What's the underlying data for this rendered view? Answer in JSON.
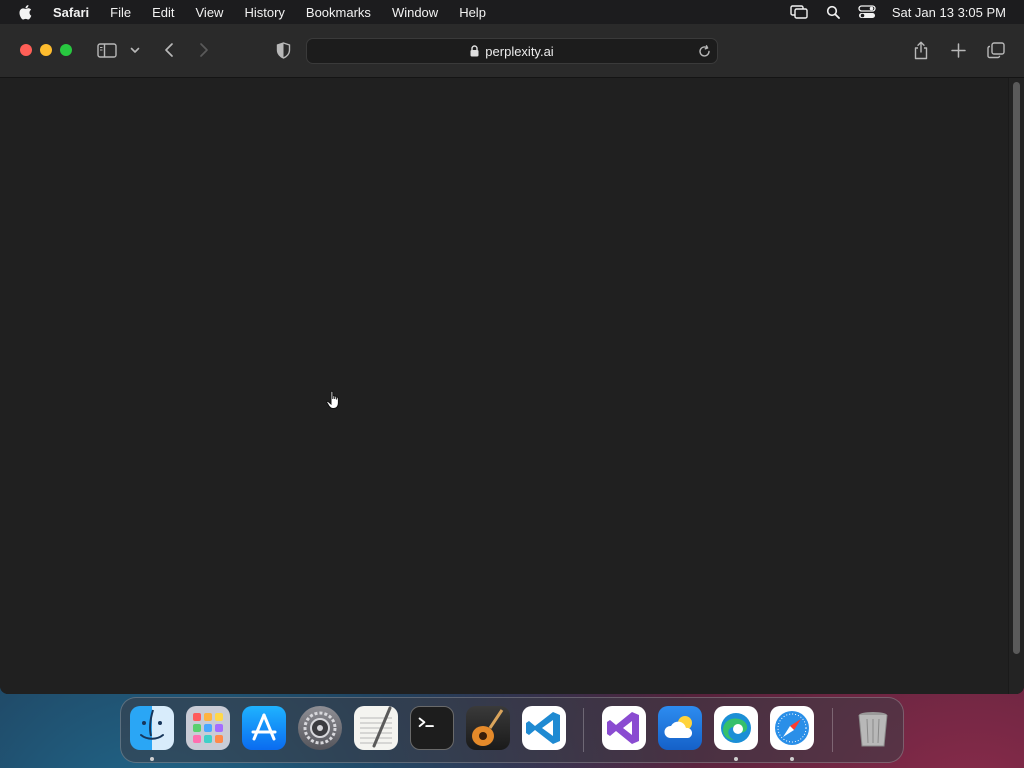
{
  "menubar": {
    "apple_icon": "apple-logo-icon",
    "app_name": "Safari",
    "items": [
      "File",
      "Edit",
      "View",
      "History",
      "Bookmarks",
      "Window",
      "Help"
    ],
    "status_icons": [
      "screen-mirroring-icon",
      "spotlight-search-icon",
      "control-center-icon"
    ],
    "clock": "Sat Jan 13  3:05 PM"
  },
  "toolbar": {
    "traffic_lights": {
      "close": "#ff5f57",
      "minimize": "#febc2e",
      "zoom": "#28c840"
    },
    "icons": {
      "sidebar": "sidebar-icon",
      "tab_groups": "chevron-down-icon",
      "back": "chevron-left-icon",
      "forward": "chevron-right-icon",
      "privacy": "shield-icon",
      "share": "share-icon",
      "new_tab": "plus-icon",
      "tab_overview": "tab-overview-icon"
    },
    "address": {
      "lock_icon": "lock-icon",
      "url": "perplexity.ai",
      "reload_icon": "reload-icon"
    }
  },
  "content": {
    "background": "#202020",
    "cursor_icon": "hand-pointer-icon"
  },
  "dock": {
    "apps": [
      {
        "name": "Finder",
        "icon": "finder-icon",
        "running": true
      },
      {
        "name": "Launchpad",
        "icon": "launchpad-icon",
        "running": false
      },
      {
        "name": "App Store",
        "icon": "app-store-icon",
        "running": false
      },
      {
        "name": "System Settings",
        "icon": "system-settings-icon",
        "running": false
      },
      {
        "name": "TextEdit",
        "icon": "textedit-icon",
        "running": false
      },
      {
        "name": "Terminal",
        "icon": "terminal-icon",
        "running": false
      },
      {
        "name": "GarageBand",
        "icon": "garageband-icon",
        "running": false
      },
      {
        "name": "Visual Studio Code",
        "icon": "vscode-icon",
        "running": false
      },
      {
        "name": "Visual Studio",
        "icon": "visual-studio-icon",
        "running": false
      },
      {
        "name": "Weather",
        "icon": "weather-icon",
        "running": false
      },
      {
        "name": "Microsoft Edge",
        "icon": "edge-icon",
        "running": true
      },
      {
        "name": "Safari",
        "icon": "safari-icon",
        "running": true
      },
      {
        "name": "Trash",
        "icon": "trash-icon",
        "running": false
      }
    ]
  }
}
